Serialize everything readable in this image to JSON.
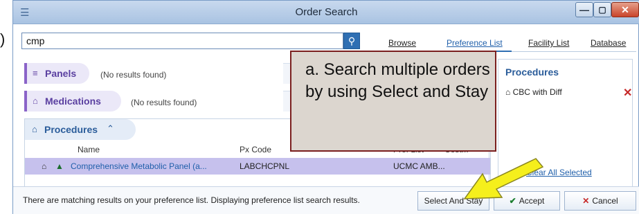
{
  "outside": {
    "paren": ")"
  },
  "window": {
    "title": "Order Search"
  },
  "search": {
    "value": "cmp"
  },
  "tabs": [
    {
      "label": "Browse"
    },
    {
      "label": "Preference List"
    },
    {
      "label": "Facility List"
    },
    {
      "label": "Database"
    }
  ],
  "groups": {
    "panels": {
      "label": "Panels",
      "note": "(No results found)"
    },
    "medications": {
      "label": "Medications",
      "note": "(No results found)"
    },
    "procedures": {
      "label": "Procedures"
    }
  },
  "columns": {
    "name": "Name",
    "px_code": "Px Code",
    "pref_list": "Pref List",
    "cost": "Cost..."
  },
  "results": [
    {
      "name": "Comprehensive Metabolic Panel (a...",
      "px_code": "LABCHCPNL",
      "pref_list": "UCMC AMB..."
    }
  ],
  "selected": {
    "title": "Procedures",
    "items": [
      {
        "label": "CBC with Diff"
      }
    ],
    "clear_label": "Clear All Selected"
  },
  "status": "There are matching results on your preference list. Displaying preference list search results.",
  "buttons": {
    "select_stay": "Select And Stay",
    "accept": "Accept",
    "cancel": "Cancel"
  },
  "callout": {
    "text": "a. Search multiple orders by using Select and Stay"
  },
  "colors": {
    "accent": "#2f6fb3",
    "callout_border": "#7a1f1f",
    "arrow": "#f5ef1c"
  }
}
